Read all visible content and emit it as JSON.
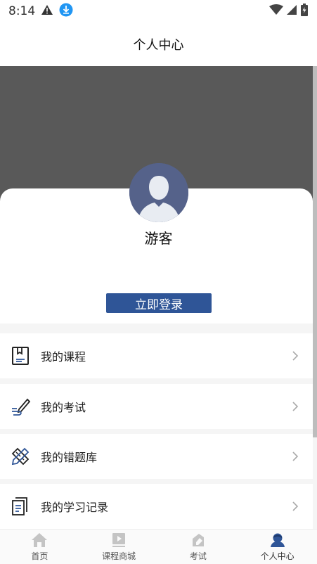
{
  "status_bar": {
    "time": "8:14"
  },
  "header": {
    "title": "个人中心"
  },
  "profile": {
    "name": "游客",
    "login_label": "立即登录"
  },
  "menu": [
    {
      "label": "我的课程",
      "icon": "book-icon"
    },
    {
      "label": "我的考试",
      "icon": "pen-icon"
    },
    {
      "label": "我的错题库",
      "icon": "pencil-ruler-icon"
    },
    {
      "label": "我的学习记录",
      "icon": "document-icon"
    }
  ],
  "tabs": [
    {
      "label": "首页",
      "icon": "home-icon",
      "active": false
    },
    {
      "label": "课程商城",
      "icon": "video-icon",
      "active": false
    },
    {
      "label": "考试",
      "icon": "exam-icon",
      "active": false
    },
    {
      "label": "个人中心",
      "icon": "user-icon",
      "active": true
    }
  ],
  "colors": {
    "accent": "#2f5597",
    "hero": "#595959",
    "avatar": "#55628a",
    "active_tab": "#2f5597"
  }
}
